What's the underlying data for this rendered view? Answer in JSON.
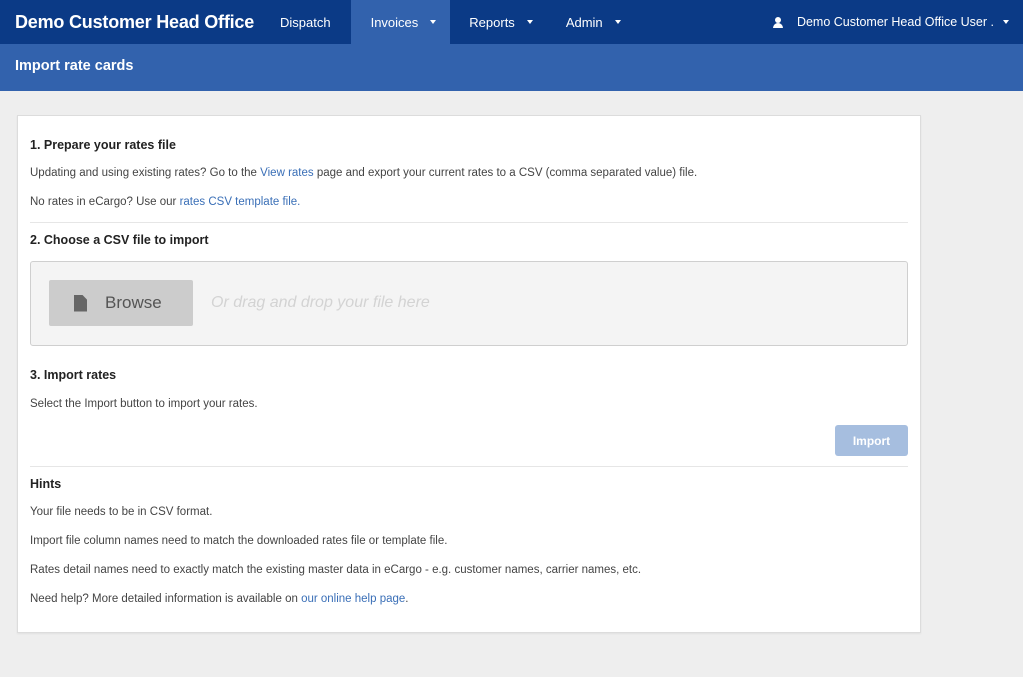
{
  "app": {
    "title": "Demo Customer Head Office"
  },
  "nav": {
    "items": [
      {
        "label": "Dispatch"
      },
      {
        "label": "Invoices"
      },
      {
        "label": "Reports"
      },
      {
        "label": "Admin"
      }
    ],
    "active": "Invoices",
    "user_label": "Demo Customer Head Office User ."
  },
  "page": {
    "title": "Import rate cards"
  },
  "step1": {
    "title": "1. Prepare your rates file",
    "line1_before": "Updating and using existing rates? Go to the ",
    "line1_link": "View rates",
    "line1_after": " page and export your current rates to a CSV (comma separated value) file.",
    "line2_before": "No rates in eCargo? Use our ",
    "line2_link": "rates CSV template file."
  },
  "step2": {
    "title": "2. Choose a CSV file to import",
    "browse_label": "Browse",
    "drop_hint": "Or drag and drop your file here"
  },
  "step3": {
    "title": "3. Import rates",
    "description": "Select the Import button to import your rates.",
    "import_label": "Import"
  },
  "hints": {
    "title": "Hints",
    "items": [
      "Your file needs to be in CSV format.",
      "Import file column names need to match the downloaded rates file or template file.",
      "Rates detail names need to exactly match the existing master data in eCargo - e.g. customer names, carrier names, etc."
    ],
    "help_before": "Need help? More detailed information is available on ",
    "help_link": "our online help page",
    "help_after": "."
  },
  "colors": {
    "navbar": "#0b3a86",
    "active_nav": "#3262ad",
    "subheader": "#3262ad",
    "link": "#3a6fb7",
    "import_button_disabled": "#a6bedf"
  },
  "icons": [
    "user-icon",
    "caret-down-icon",
    "file-icon"
  ]
}
